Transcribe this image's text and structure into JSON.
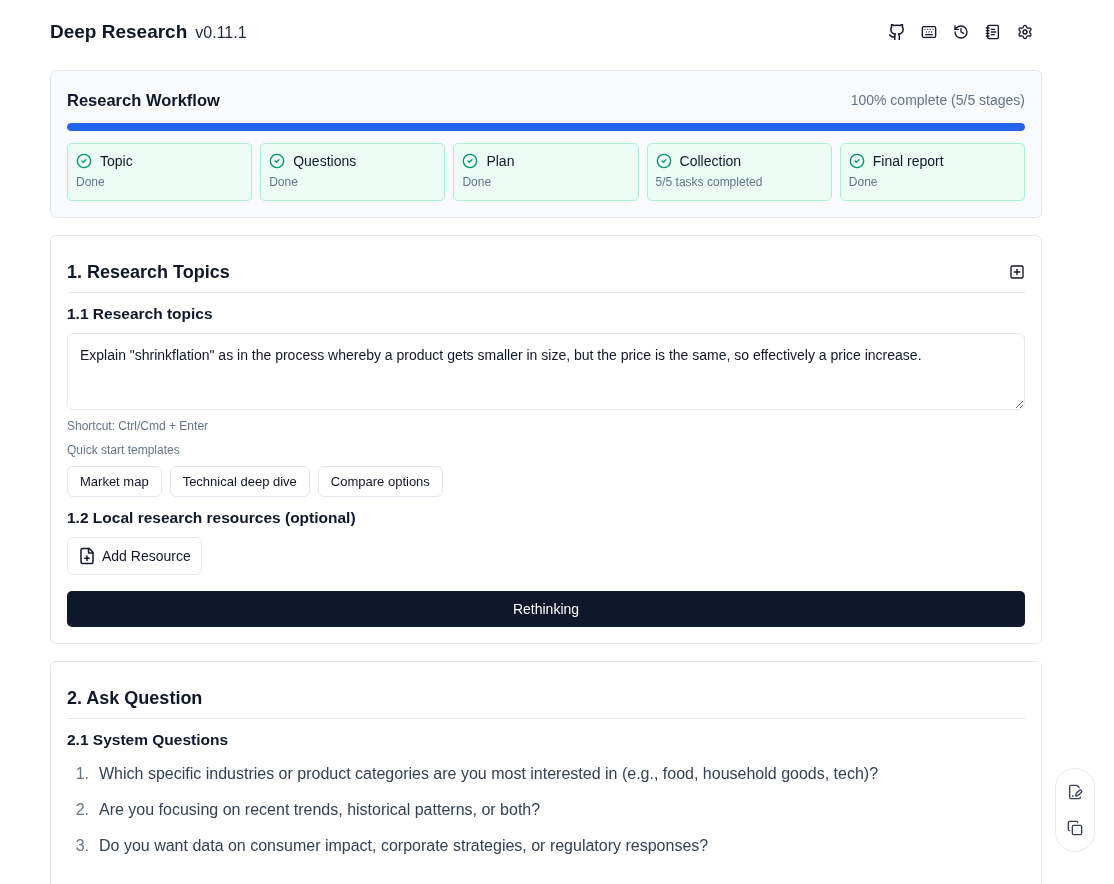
{
  "header": {
    "title": "Deep Research",
    "version": "v0.11.1"
  },
  "workflow": {
    "title": "Research Workflow",
    "summary": "100% complete (5/5 stages)",
    "level": 1,
    "stages": [
      {
        "name": "Topic",
        "status": "Done",
        "done": true
      },
      {
        "name": "Questions",
        "status": "Done",
        "done": true
      },
      {
        "name": "Plan",
        "status": "Done",
        "done": true
      },
      {
        "name": "Collection",
        "status": "5/5 tasks completed",
        "done": true
      },
      {
        "name": "Final report",
        "status": "Done",
        "done": true
      }
    ]
  },
  "research_topics": {
    "title": "1. Research Topics",
    "topics_heading": "1.1 Research topics",
    "topic_field": {
      "value": "Explain \"shrinkflation\" as in the process whereby a product gets smaller in size, but the price is the same, so effectively a price increase."
    },
    "shortcut_hint": "Shortcut: Ctrl/Cmd + Enter",
    "templates_label": "Quick start templates",
    "templates": [
      "Market map",
      "Technical deep dive",
      "Compare options"
    ],
    "resources_heading": "1.2 Local research resources (optional)",
    "add_resource_button": "Add Resource",
    "submit_button": "Rethinking"
  },
  "ask_question": {
    "title": "2. Ask Question",
    "system_questions_heading": "2.1 System Questions",
    "questions": [
      {
        "number": "1.",
        "text": "Which specific industries or product categories are you most interested in (e.g., food, household goods, tech)?"
      },
      {
        "number": "2.",
        "text": "Are you focusing on recent trends, historical patterns, or both?"
      },
      {
        "number": "3.",
        "text": "Do you want data on consumer impact, corporate strategies, or regulatory responses?"
      }
    ]
  }
}
